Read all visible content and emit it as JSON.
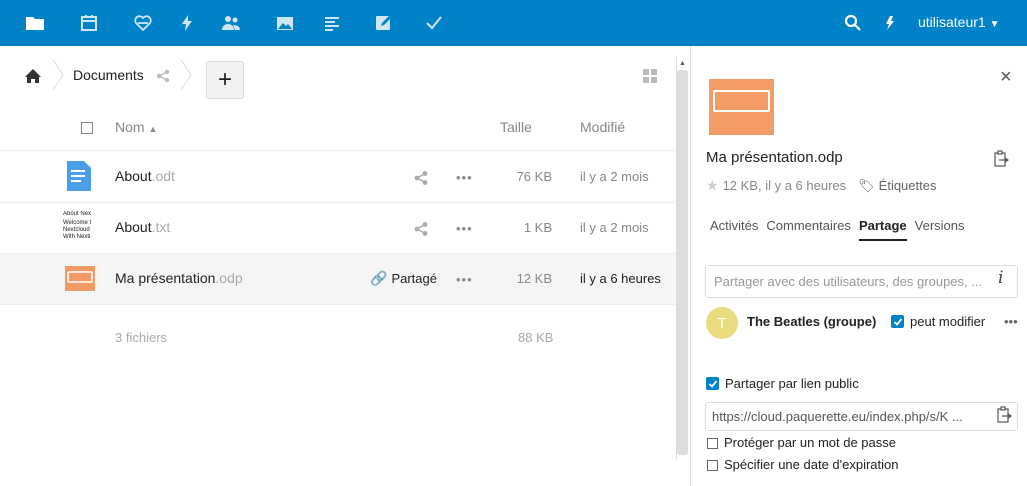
{
  "topbar": {
    "apps": [
      "files-icon",
      "calendar-icon",
      "activity-heart-icon",
      "activity-icon",
      "contacts-icon",
      "gallery-icon",
      "notes-icon",
      "edit-icon",
      "tasks-icon"
    ],
    "user": "utilisateur1"
  },
  "breadcrumb": {
    "folder": "Documents",
    "add_label": "+"
  },
  "list": {
    "col_name": "Nom",
    "col_size": "Taille",
    "col_modified": "Modifié",
    "rows": [
      {
        "name": "About",
        "ext": ".odt",
        "size": "76 KB",
        "modified": "il y a 2 mois",
        "shared": ""
      },
      {
        "name": "About",
        "ext": ".txt",
        "size": "1 KB",
        "modified": "il y a 2 mois",
        "shared": ""
      },
      {
        "name": "Ma présentation",
        "ext": ".odp",
        "size": "12 KB",
        "modified": "il y a 6 heures",
        "shared": "Partagé"
      }
    ],
    "txt_preview": [
      "About Nex",
      "Welcome t",
      "Nextcloud",
      "With Nexti"
    ],
    "summary_files": "3 fichiers",
    "summary_size": "88 KB",
    "dots": "•••"
  },
  "sidebar": {
    "close": "×",
    "filename": "Ma présentation.odp",
    "meta": "12 KB, il y a 6 heures",
    "tags_label": "Étiquettes",
    "tabs": [
      "Activités",
      "Commentaires",
      "Partage",
      "Versions"
    ],
    "active_tab": "Partage",
    "share_placeholder": "Partager avec des utilisateurs, des groupes, ...",
    "info": "i",
    "avatar_letter": "T",
    "group_name": "The Beatles (groupe)",
    "can_edit": "peut modifier",
    "dots": "•••",
    "public_link_label": "Partager par lien public",
    "link_url": "https://cloud.paquerette.eu/index.php/s/K  ...",
    "password_label": "Protéger par un mot de passe",
    "expiry_label": "Spécifier une date d'expiration"
  },
  "colors": {
    "topbar": "#0082c9",
    "odp_orange": "#f29b65",
    "odt_blue": "#4a9de8",
    "avatar": "#eadb7e"
  }
}
